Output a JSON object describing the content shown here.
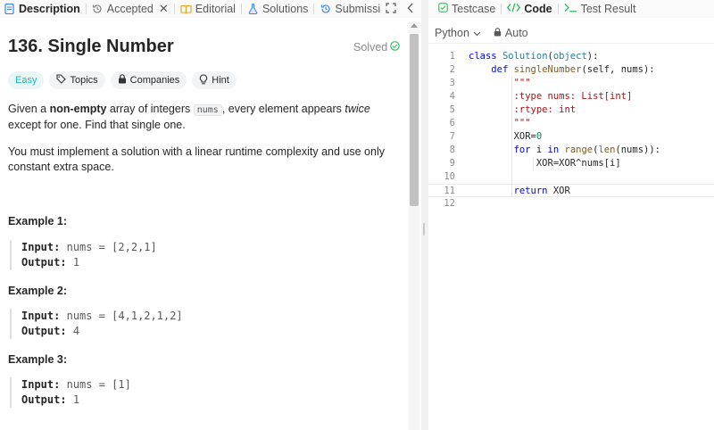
{
  "left_tabs": [
    {
      "label": "Description",
      "icon": "description-icon",
      "active": true
    },
    {
      "label": "Accepted",
      "icon": "history-icon",
      "active": false,
      "close": "✕"
    },
    {
      "label": "Editorial",
      "icon": "book-icon",
      "active": false
    },
    {
      "label": "Solutions",
      "icon": "flask-icon",
      "active": false
    },
    {
      "label": "Submissions",
      "icon": "history-icon",
      "active": false
    }
  ],
  "problem": {
    "title": "136. Single Number",
    "solved_label": "Solved",
    "chips": [
      "Easy",
      "Topics",
      "Companies",
      "Hint"
    ],
    "para1": {
      "t1": "Given a ",
      "b1": "non-empty",
      "t2": " array of integers ",
      "code": "nums",
      "t3": ", every element appears ",
      "i1": "twice",
      "t4": " except for one. Find that single one."
    },
    "para2": "You must implement a solution with a linear runtime complexity and use only constant extra space.",
    "examples": [
      {
        "title": "Example 1:",
        "input_key": "Input:",
        "input": "nums = [2,2,1]",
        "output_key": "Output:",
        "output": "1"
      },
      {
        "title": "Example 2:",
        "input_key": "Input:",
        "input": "nums = [4,1,2,1,2]",
        "output_key": "Output:",
        "output": "4"
      },
      {
        "title": "Example 3:",
        "input_key": "Input:",
        "input": "nums = [1]",
        "output_key": "Output:",
        "output": "1"
      }
    ]
  },
  "right_tabs": [
    {
      "label": "Testcase",
      "icon": "checkbox-icon",
      "active": false
    },
    {
      "label": "Code",
      "icon": "code-icon",
      "active": true
    },
    {
      "label": "Test Result",
      "icon": "terminal-icon",
      "active": false
    }
  ],
  "toolbar": {
    "language": "Python",
    "auto_label": "Auto"
  },
  "code_lines": [
    {
      "n": "1",
      "segs": [
        [
          "kw",
          "class "
        ],
        [
          "cls",
          "Solution"
        ],
        [
          "",
          "("
        ],
        [
          "cls",
          "object"
        ],
        [
          "",
          "):"
        ]
      ]
    },
    {
      "n": "2",
      "segs": [
        [
          "",
          "    "
        ],
        [
          "kw",
          "def "
        ],
        [
          "fn",
          "singleNumber"
        ],
        [
          "",
          "(self, nums):"
        ]
      ]
    },
    {
      "n": "3",
      "segs": [
        [
          "",
          "        "
        ],
        [
          "str",
          "\"\"\""
        ]
      ]
    },
    {
      "n": "4",
      "segs": [
        [
          "",
          "        "
        ],
        [
          "str",
          ":type nums: List[int]"
        ]
      ]
    },
    {
      "n": "5",
      "segs": [
        [
          "",
          "        "
        ],
        [
          "str",
          ":rtype: int"
        ]
      ]
    },
    {
      "n": "6",
      "segs": [
        [
          "",
          "        "
        ],
        [
          "str",
          "\"\"\""
        ]
      ]
    },
    {
      "n": "7",
      "segs": [
        [
          "",
          "        XOR="
        ],
        [
          "num",
          "0"
        ]
      ]
    },
    {
      "n": "8",
      "segs": [
        [
          "",
          "        "
        ],
        [
          "kw",
          "for "
        ],
        [
          "",
          "i "
        ],
        [
          "kw",
          "in "
        ],
        [
          "fn",
          "range"
        ],
        [
          "",
          "("
        ],
        [
          "fn",
          "len"
        ],
        [
          "",
          "(nums)):"
        ]
      ]
    },
    {
      "n": "9",
      "segs": [
        [
          "",
          "            XOR=XOR^nums[i]"
        ]
      ]
    },
    {
      "n": "10",
      "segs": [
        [
          "",
          ""
        ]
      ]
    },
    {
      "n": "11",
      "segs": [
        [
          "",
          "        "
        ],
        [
          "kw",
          "return "
        ],
        [
          "",
          "XOR"
        ]
      ]
    },
    {
      "n": "12",
      "segs": [
        [
          "",
          ""
        ]
      ]
    }
  ],
  "colors": {
    "accent_green": "#2cbb5d",
    "easy": "#1cb8b8",
    "keyword": "#0000ff"
  }
}
